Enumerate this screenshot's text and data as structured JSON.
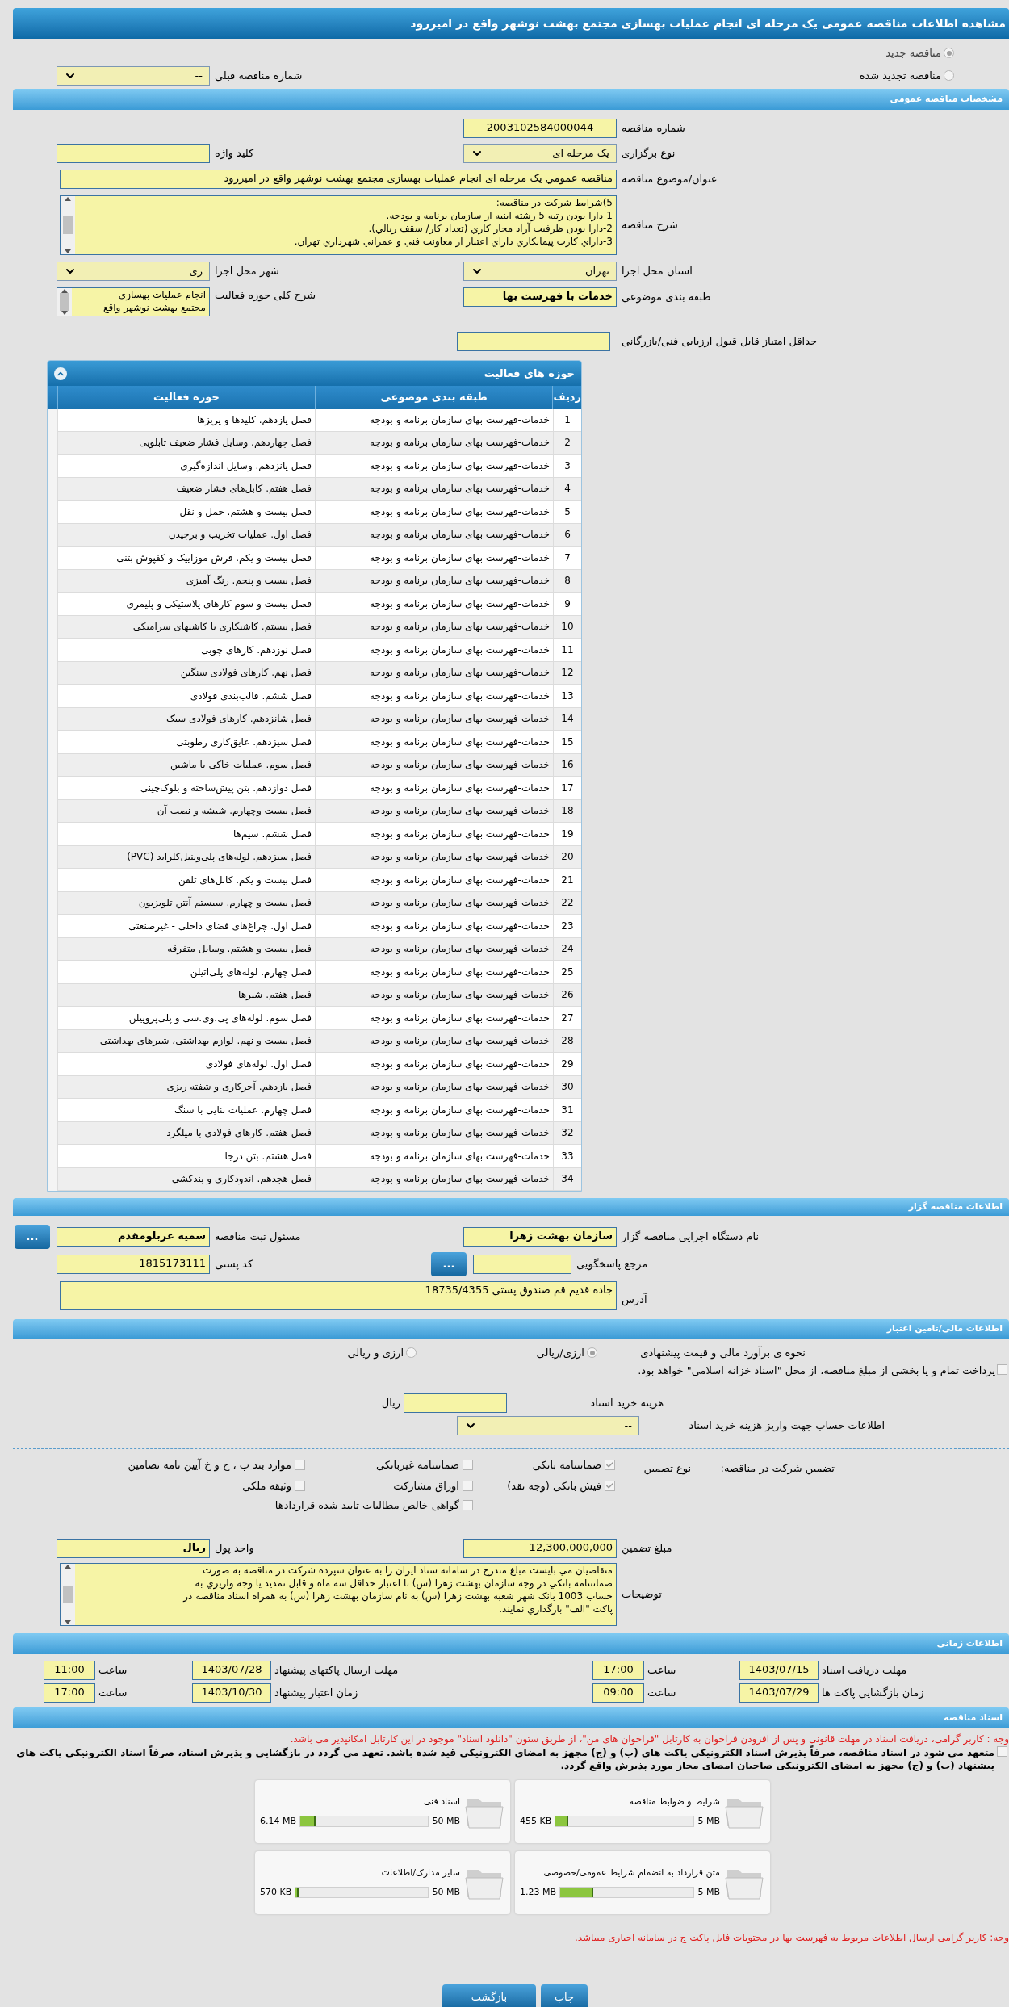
{
  "title": "مشاهده اطلاعات مناقصه عمومی یک مرحله ای انجام عملیات بهسازی مجتمع بهشت نوشهر واقع در امیررود",
  "tender_type": [
    {
      "label": "مناقصه جدید",
      "selected": true
    },
    {
      "label": "مناقصه تجدید شده",
      "selected": false
    }
  ],
  "previous_tender": {
    "label": "شماره مناقصه قبلی",
    "value": "--"
  },
  "general": {
    "header": "مشخصات مناقصه عمومی",
    "tender_number": {
      "label": "شماره مناقصه",
      "value": "2003102584000044"
    },
    "holding_type": {
      "label": "نوع برگزاری",
      "value": "یک مرحله ای"
    },
    "keyword": {
      "label": "کلید واژه"
    },
    "subject": {
      "label": "عنوان/موضوع مناقصه",
      "value": "مناقصه عمومي یک مرحله ای انجام عملیات بهسازی مجتمع بهشت نوشهر واقع در امیررود"
    },
    "description": {
      "label": "شرح مناقصه",
      "lines": [
        "5)شرایط شرکت در مناقصه:",
        "1-دارا بودن رتبه 5 رشته ابنیه از سازمان برنامه و بودجه.",
        "2-دارا بودن ظرفیت آزاد مجاز کاري (تعداد کار/ سقف ريالي).",
        "3-داراي کارت پیمانکاري داراي اعتبار از معاونت فني و عمراني شهرداري تهران."
      ]
    },
    "province": {
      "label": "استان محل اجرا",
      "value": "تهران"
    },
    "city": {
      "label": "شهر محل اجرا",
      "value": "ری"
    },
    "category": {
      "label": "طبقه بندی موضوعی",
      "value": "خدمات با فهرست بها"
    },
    "activity_summary": {
      "label": "شرح کلی حوزه فعالیت",
      "lines": [
        "انجام عملیات بهسازی",
        "مجتمع بهشت نوشهر واقع"
      ]
    },
    "min_score": {
      "label": "حداقل امتیاز قابل قبول ارزیابی فنی/بازرگانی"
    }
  },
  "activities": {
    "title": "حوزه های فعالیت",
    "columns": [
      "ردیف",
      "طبقه بندی موضوعی",
      "حوزه فعالیت"
    ],
    "rows": [
      {
        "num": "1",
        "category": "خدمات-فهرست بهای سازمان برنامه و بودجه",
        "field": "فصل یازدهم. کلیدها و پریزها"
      },
      {
        "num": "2",
        "category": "خدمات-فهرست بهای سازمان برنامه و بودجه",
        "field": "فصل چهاردهم. وسایل فشار ضعیف تابلویی"
      },
      {
        "num": "3",
        "category": "خدمات-فهرست بهای سازمان برنامه و بودجه",
        "field": "فصل پانزدهم. وسایل اندازه‌گیری"
      },
      {
        "num": "4",
        "category": "خدمات-فهرست بهای سازمان برنامه و بودجه",
        "field": "فصل هفتم. کابل‌های فشار ضعیف"
      },
      {
        "num": "5",
        "category": "خدمات-فهرست بهای سازمان برنامه و بودجه",
        "field": "فصل بیست و هشتم. حمل و نقل"
      },
      {
        "num": "6",
        "category": "خدمات-فهرست بهای سازمان برنامه و بودجه",
        "field": "فصل اول. عملیات تخریب و برچیدن"
      },
      {
        "num": "7",
        "category": "خدمات-فهرست بهای سازمان برنامه و بودجه",
        "field": "فصل بیست و یکم. فرش موزاییک و کفپوش بتنی"
      },
      {
        "num": "8",
        "category": "خدمات-فهرست بهای سازمان برنامه و بودجه",
        "field": "فصل بیست و پنجم. رنگ آمیزی"
      },
      {
        "num": "9",
        "category": "خدمات-فهرست بهای سازمان برنامه و بودجه",
        "field": "فصل بیست و سوم کارهای پلاستیکی و پلیمری"
      },
      {
        "num": "10",
        "category": "خدمات-فهرست بهای سازمان برنامه و بودجه",
        "field": "فصل بیستم. کاشیکاری با کاشیهای سرامیکی"
      },
      {
        "num": "11",
        "category": "خدمات-فهرست بهای سازمان برنامه و بودجه",
        "field": "فصل نوزدهم. کارهای چوبی"
      },
      {
        "num": "12",
        "category": "خدمات-فهرست بهای سازمان برنامه و بودجه",
        "field": "فصل نهم. کارهای فولادی سنگین"
      },
      {
        "num": "13",
        "category": "خدمات-فهرست بهای سازمان برنامه و بودجه",
        "field": "فصل ششم. قالب‌بندی فولادی"
      },
      {
        "num": "14",
        "category": "خدمات-فهرست بهای سازمان برنامه و بودجه",
        "field": "فصل شانزدهم. کارهای فولادی سبک"
      },
      {
        "num": "15",
        "category": "خدمات-فهرست بهای سازمان برنامه و بودجه",
        "field": "فصل سیزدهم. عایق‌کاری رطوبتی"
      },
      {
        "num": "16",
        "category": "خدمات-فهرست بهای سازمان برنامه و بودجه",
        "field": "فصل سوم. عملیات خاکی با ماشین"
      },
      {
        "num": "17",
        "category": "خدمات-فهرست بهای سازمان برنامه و بودجه",
        "field": "فصل دوازدهم. بتن پیش‌ساخته و بلوک‌چینی"
      },
      {
        "num": "18",
        "category": "خدمات-فهرست بهای سازمان برنامه و بودجه",
        "field": "فصل بیست وچهارم. شیشه و نصب آن"
      },
      {
        "num": "19",
        "category": "خدمات-فهرست بهای سازمان برنامه و بودجه",
        "field": "فصل ششم. سیم‌ها"
      },
      {
        "num": "20",
        "category": "خدمات-فهرست بهای سازمان برنامه و بودجه",
        "field": "فصل سیزدهم. لوله‌های پلی‌وینیل‌کلراید (PVC)"
      },
      {
        "num": "21",
        "category": "خدمات-فهرست بهای سازمان برنامه و بودجه",
        "field": "فصل بیست و یکم. کابل‌های تلفن"
      },
      {
        "num": "22",
        "category": "خدمات-فهرست بهای سازمان برنامه و بودجه",
        "field": "فصل بیست و چهارم. سیستم آنتن تلویزیون"
      },
      {
        "num": "23",
        "category": "خدمات-فهرست بهای سازمان برنامه و بودجه",
        "field": "فصل اول. چراغ‌های فضای داخلی - غیرصنعتی"
      },
      {
        "num": "24",
        "category": "خدمات-فهرست بهای سازمان برنامه و بودجه",
        "field": "فصل بیست و هشتم. وسایل متفرقه"
      },
      {
        "num": "25",
        "category": "خدمات-فهرست بهای سازمان برنامه و بودجه",
        "field": "فصل چهارم. لوله‌های پلی‌اتیلن"
      },
      {
        "num": "26",
        "category": "خدمات-فهرست بهای سازمان برنامه و بودجه",
        "field": "فصل هفتم. شیرها"
      },
      {
        "num": "27",
        "category": "خدمات-فهرست بهای سازمان برنامه و بودجه",
        "field": "فصل سوم. لوله‌های پی.وی.سی و پلی‌پروپیلن"
      },
      {
        "num": "28",
        "category": "خدمات-فهرست بهای سازمان برنامه و بودجه",
        "field": "فصل بیست و نهم. لوازم بهداشتی، شیرهای بهداشتی"
      },
      {
        "num": "29",
        "category": "خدمات-فهرست بهای سازمان برنامه و بودجه",
        "field": "فصل اول. لوله‌های فولادی"
      },
      {
        "num": "30",
        "category": "خدمات-فهرست بهای سازمان برنامه و بودجه",
        "field": "فصل یازدهم. آجرکاری و شفته ریزی"
      },
      {
        "num": "31",
        "category": "خدمات-فهرست بهای سازمان برنامه و بودجه",
        "field": "فصل چهارم. عملیات بنایی با سنگ"
      },
      {
        "num": "32",
        "category": "خدمات-فهرست بهای سازمان برنامه و بودجه",
        "field": "فصل هفتم. کارهای فولادی با میلگرد"
      },
      {
        "num": "33",
        "category": "خدمات-فهرست بهای سازمان برنامه و بودجه",
        "field": "فصل هشتم. بتن درجا"
      },
      {
        "num": "34",
        "category": "خدمات-فهرست بهای سازمان برنامه و بودجه",
        "field": "فصل هجدهم. اندودکاری و بندکشی"
      }
    ]
  },
  "organizer": {
    "header": "اطلاعات مناقصه گزار",
    "agency": {
      "label": "نام دستگاه اجرایی مناقصه گزار",
      "value": "سازمان بهشت زهرا"
    },
    "registrar": {
      "label": "مسئول ثبت مناقصه",
      "value": "سمیه عربلومقدم",
      "button": "..."
    },
    "reference": {
      "label": "مرجع پاسخگویی",
      "button": "..."
    },
    "postal_code": {
      "label": "کد پستی",
      "value": "1815173111"
    },
    "address": {
      "label": "آدرس",
      "value": "جاده قدیم قم صندوق پستی 18735/4355"
    }
  },
  "finance": {
    "header": "اطلاعات مالی/تامین اعتبار",
    "estimate": {
      "label": "نحوه ی برآورد مالی و قیمت پیشنهادی",
      "options": [
        {
          "label": "ارزی/ریالی",
          "selected": true
        },
        {
          "label": "ارزی و ریالی",
          "selected": false
        }
      ]
    },
    "treasury": {
      "label": "پرداخت تمام و یا بخشی از مبلغ مناقصه، از محل \"اسناد خزانه اسلامی\" خواهد بود.",
      "checked": false
    },
    "doc_cost": {
      "label": "هزینه خرید اسناد",
      "unit": "ریال"
    },
    "account": {
      "label": "اطلاعات حساب جهت واریز هزینه خرید اسناد",
      "value": "--"
    }
  },
  "guarantee": {
    "label": "تضمین شرکت در مناقصه:",
    "type_label": "نوع تضمین",
    "options": [
      {
        "label": "ضمانتنامه بانکی",
        "checked": true
      },
      {
        "label": "ضمانتنامه غیربانکی",
        "checked": false
      },
      {
        "label": "موارد بند پ ، ح و خ آیین نامه تضامین",
        "checked": false
      },
      {
        "label": "فیش بانکی (وجه نقد)",
        "checked": true
      },
      {
        "label": "اوراق مشارکت",
        "checked": false
      },
      {
        "label": "وثیقه ملکی",
        "checked": false
      },
      {
        "label": "گواهی خالص مطالبات تایید شده قراردادها",
        "checked": false
      }
    ],
    "amount": {
      "label": "مبلغ تضمین",
      "value": "12,300,000,000"
    },
    "currency": {
      "label": "واحد پول",
      "value": "ریال"
    },
    "notes": {
      "label": "توضیحات",
      "lines": [
        "متقاضیان مي بایست مبلغ مندرج در سامانه ستاد ایران را به عنوان سپرده شرکت در مناقصه به صورت",
        "ضمانتنامه بانکي در وجه سازمان بهشت زهرا (س) با اعتبار حداقل سه ماه و قابل تمدید یا وجه واریزي به",
        "حساب 1003 بانک شهر شعبه بهشت زهرا (س) به نام سازمان بهشت زهرا (س) به همراه اسناد مناقصه در",
        "پاکت \"الف\" بارگذاري نمایند."
      ]
    }
  },
  "timing": {
    "header": "اطلاعات زمانی",
    "items": [
      {
        "label": "مهلت دریافت اسناد",
        "date": "1403/07/15",
        "time_label": "ساعت",
        "time": "17:00"
      },
      {
        "label": "مهلت ارسال پاکتهای پیشنهاد",
        "date": "1403/07/28",
        "time_label": "ساعت",
        "time": "11:00"
      },
      {
        "label": "زمان بازگشایی پاکت ها",
        "date": "1403/07/29",
        "time_label": "ساعت",
        "time": "09:00"
      },
      {
        "label": "زمان اعتبار پیشنهاد",
        "date": "1403/10/30",
        "time_label": "ساعت",
        "time": "17:00"
      }
    ]
  },
  "documents": {
    "header": "اسناد مناقصه",
    "notice": "وجه : کاربر گرامی، دریافت اسناد در مهلت قانونی و پس از افزودن فراخوان به کارتابل \"فراخوان های من\"، از طریق ستون \"دانلود اسناد\" موجود در این کارتابل امکانپذیر می باشد.",
    "commitment": {
      "checked": false,
      "text": "متعهد می شود در اسناد مناقصه، صرفاً پذیرش اسناد الکترونیکی پاکت های (ب) و (ج) مجهز به امضای الکترونیکی قید شده باشد. تعهد می گردد در بازگشایی و پذیرش اسناد، صرفاً اسناد الکترونیکی پاکت های پیشنهاد (ب) و (ج) مجهز به امضای الکترونیکی صاحبان امضای مجاز مورد پذیرش واقع گردد."
    },
    "files": [
      {
        "name": "شرایط و ضوابط مناقصه",
        "size": "455 KB",
        "limit": "5 MB",
        "level": 0.09
      },
      {
        "name": "اسناد فنی",
        "size": "6.14 MB",
        "limit": "50 MB",
        "level": 0.12
      },
      {
        "name": "متن قرارداد به انضمام شرایط عمومی/خصوصی",
        "size": "1.23 MB",
        "limit": "5 MB",
        "level": 0.25
      },
      {
        "name": "سایر مدارک/اطلاعات",
        "size": "570 KB",
        "limit": "50 MB",
        "level": 0.02
      }
    ],
    "footer_note": "وجه: کاربر گرامی ارسال اطلاعات مربوط به فهرست بها در محتویات فایل پاکت ج در سامانه اجباری میباشد."
  },
  "buttons": [
    "چاپ",
    "بازگشت"
  ]
}
